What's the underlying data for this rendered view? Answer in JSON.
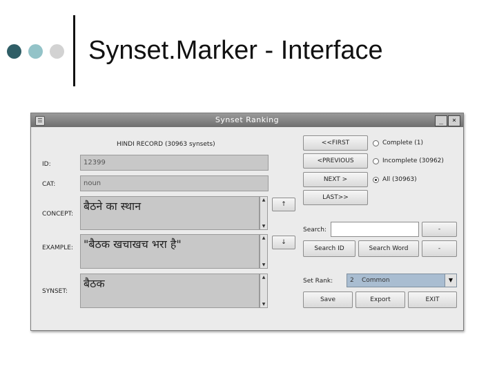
{
  "slide": {
    "title": "Synset.Marker - Interface"
  },
  "window": {
    "title": "Synset Ranking",
    "minimize": "_",
    "close": "×",
    "record_title": "HINDI RECORD (30963 synsets)",
    "labels": {
      "id": "ID:",
      "cat": "CAT:",
      "concept": "CONCEPT:",
      "example": "EXAMPLE:",
      "synset": "SYNSET:"
    },
    "values": {
      "id": "12399",
      "cat": "noun",
      "concept": "बैठने का स्थान",
      "example": "\"बैठक खचाखच भरा है\"",
      "synset": "बैठक"
    },
    "side_buttons": {
      "up": "↑",
      "down": "↓"
    },
    "nav": {
      "first": "<<FIRST",
      "previous": "<PREVIOUS",
      "next": "NEXT >",
      "last": "LAST>>"
    },
    "filters": {
      "complete": "Complete (1)",
      "incomplete": "Incomplete (30962)",
      "all": "All (30963)"
    },
    "search": {
      "label": "Search:",
      "by_id": "Search ID",
      "by_word": "Search Word",
      "aux1": "-",
      "aux2": "-"
    },
    "rank": {
      "label": "Set Rank:",
      "value": "2",
      "option": "Common"
    },
    "actions": {
      "save": "Save",
      "export": "Export",
      "exit": "EXIT"
    }
  }
}
